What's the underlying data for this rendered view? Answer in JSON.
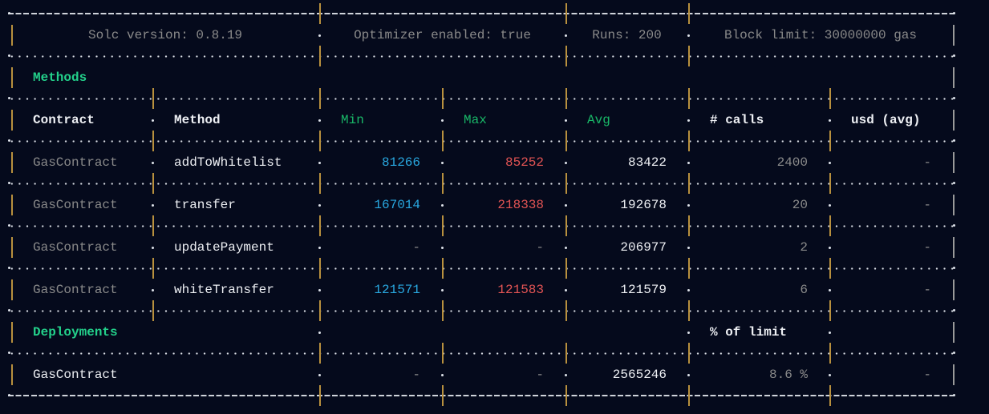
{
  "colors": {
    "pipe": "#b8903e",
    "green": "#23d18b",
    "header_green": "#19b868",
    "cyan": "#29a8e0",
    "red": "#e35454",
    "white": "#eef0f4",
    "gray": "#8a8a8a"
  },
  "config": {
    "solc": "Solc version: 0.8.19",
    "optimizer": "Optimizer enabled: true",
    "runs": "Runs: 200",
    "block_limit": "Block limit: 30000000 gas"
  },
  "methods_title": "Methods",
  "headers": {
    "contract": "Contract",
    "method": "Method",
    "min": "Min",
    "max": "Max",
    "avg": "Avg",
    "calls": "# calls",
    "usd": "usd (avg)"
  },
  "methods": [
    {
      "contract": "GasContract",
      "method": "addToWhitelist",
      "min": "81266",
      "max": "85252",
      "avg": "83422",
      "calls": "2400",
      "usd": "-"
    },
    {
      "contract": "GasContract",
      "method": "transfer",
      "min": "167014",
      "max": "218338",
      "avg": "192678",
      "calls": "20",
      "usd": "-"
    },
    {
      "contract": "GasContract",
      "method": "updatePayment",
      "min": "-",
      "max": "-",
      "avg": "206977",
      "calls": "2",
      "usd": "-"
    },
    {
      "contract": "GasContract",
      "method": "whiteTransfer",
      "min": "121571",
      "max": "121583",
      "avg": "121579",
      "calls": "6",
      "usd": "-"
    }
  ],
  "deployments_title": "Deployments",
  "percent_header": "% of limit",
  "deployments": [
    {
      "contract": "GasContract",
      "min": "-",
      "max": "-",
      "avg": "2565246",
      "percent": "8.6 %",
      "usd": "-"
    }
  ]
}
